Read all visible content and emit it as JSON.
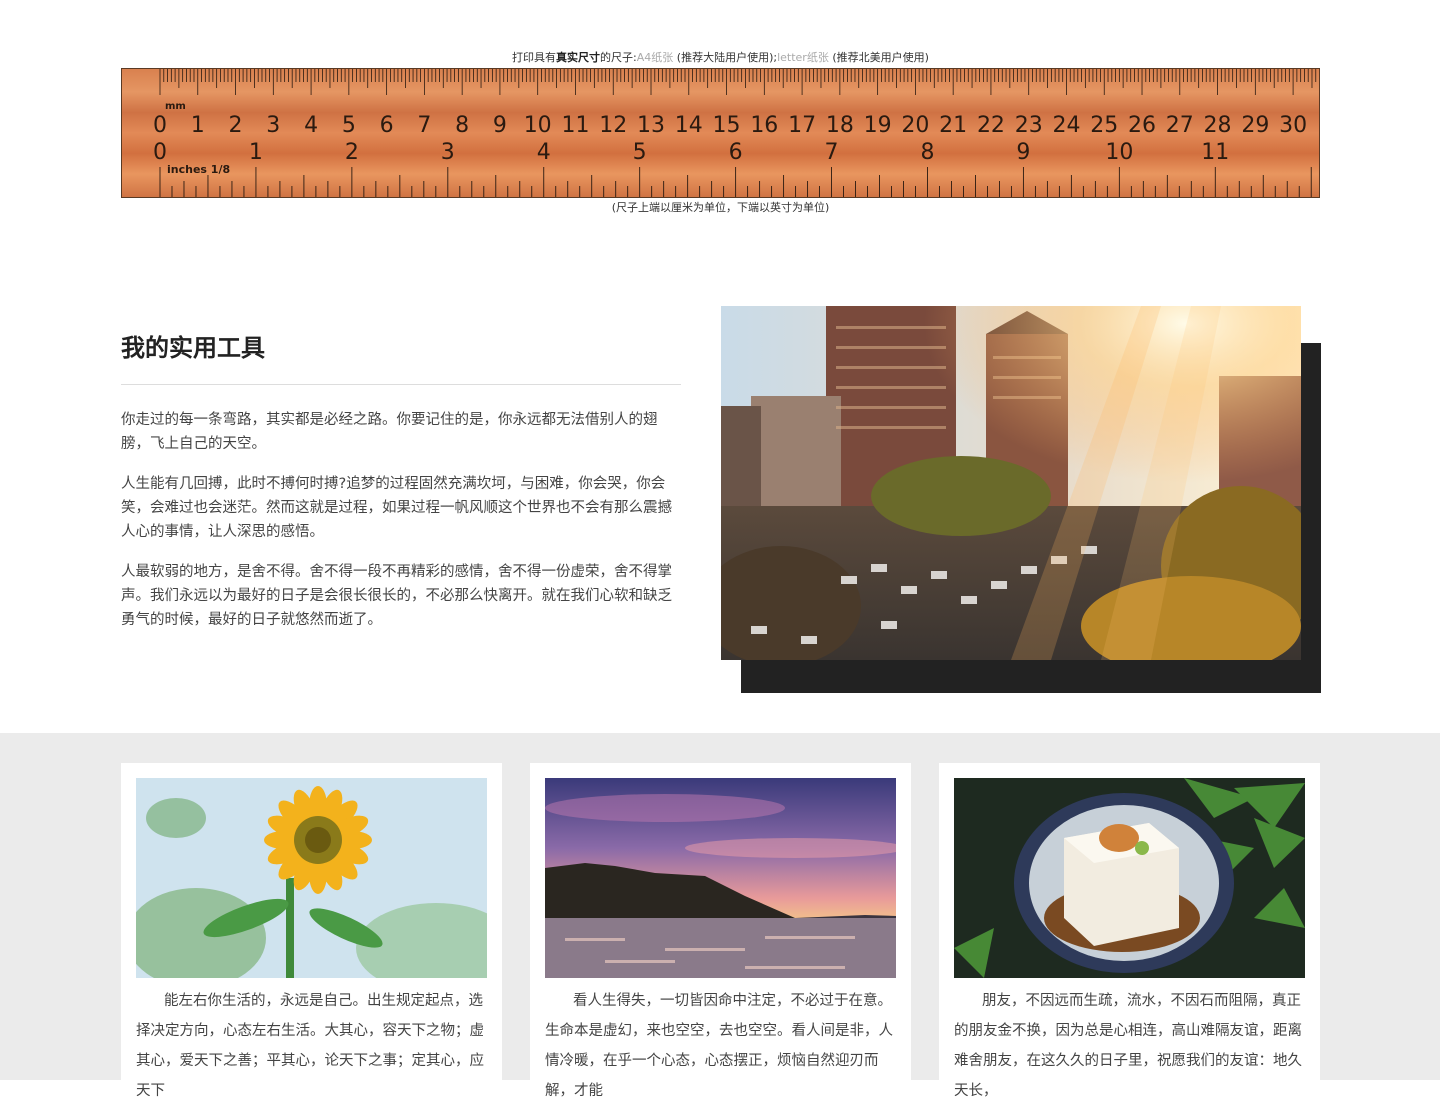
{
  "ruler": {
    "top_prefix": "打印具有",
    "top_bold": "真实尺寸",
    "top_mid": "的尺子:",
    "link_a4": "A4纸张",
    "a4_note": " (推荐大陆用户使用);",
    "link_letter": "letter纸张",
    "letter_note": " (推荐北美用户使用)",
    "bottom_note": "(尺子上端以厘米为单位，下端以英寸为单位)",
    "mm_label": "mm",
    "inch_label": "inches 1/8",
    "cm_numbers": [
      "0",
      "1",
      "2",
      "3",
      "4",
      "5",
      "6",
      "7",
      "8",
      "9",
      "10",
      "11",
      "12",
      "13",
      "14",
      "15",
      "16",
      "17",
      "18",
      "19",
      "20",
      "21",
      "22",
      "23",
      "24",
      "25",
      "26",
      "27",
      "28",
      "29",
      "30"
    ],
    "inch_numbers": [
      "0",
      "1",
      "2",
      "3",
      "4",
      "5",
      "6",
      "7",
      "8",
      "9",
      "10",
      "11"
    ]
  },
  "about": {
    "title": "我的实用工具",
    "paragraphs": [
      "你走过的每一条弯路，其实都是必经之路。你要记住的是，你永远都无法借别人的翅膀，飞上自己的天空。",
      "人生能有几回搏，此时不搏何时搏?追梦的过程固然充满坎坷，与困难，你会哭，你会笑，会难过也会迷茫。然而这就是过程，如果过程一帆风顺这个世界也不会有那么震撼人心的事情，让人深思的感悟。",
      "人最软弱的地方，是舍不得。舍不得一段不再精彩的感情，舍不得一份虚荣，舍不得掌声。我们永远以为最好的日子是会很长很长的，不必那么快离开。就在我们心软和缺乏勇气的时候，最好的日子就悠然而逝了。"
    ]
  },
  "cards": [
    {
      "text": "能左右你生活的，永远是自己。出生规定起点，选择决定方向，心态左右生活。大其心，容天下之物；虚其心，爱天下之善；平其心，论天下之事；定其心，应天下"
    },
    {
      "text": "看人生得失，一切皆因命中注定，不必过于在意。生命本是虚幻，来也空空，去也空空。看人间是非，人情冷暖，在乎一个心态，心态摆正，烦恼自然迎刃而解，才能"
    },
    {
      "text": "朋友，不因远而生疏，流水，不因石而阻隔，真正的朋友金不换，因为总是心相连，高山难隔友谊，距离难舍朋友，在这久久的日子里，祝愿我们的友谊：地久天长，"
    }
  ],
  "colors": {
    "ruler_wood": "#d9814f",
    "ruler_border": "#5a3a24",
    "ink": "#2a1a10",
    "section_bg": "#ebebeb"
  }
}
